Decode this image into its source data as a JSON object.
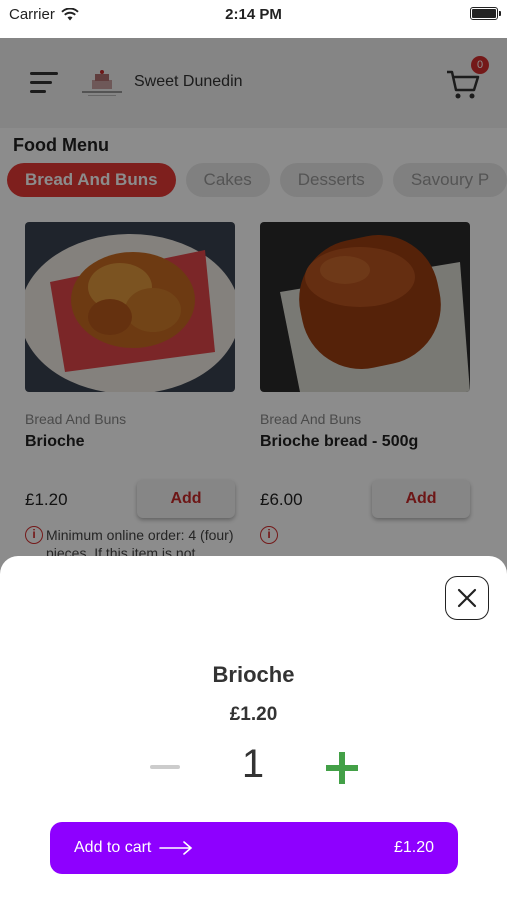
{
  "status_bar": {
    "carrier": "Carrier",
    "time": "2:14 PM"
  },
  "header": {
    "brand": "Sweet Dunedin",
    "cart_count": "0"
  },
  "menu": {
    "title": "Food Menu",
    "categories": [
      "Bread And Buns",
      "Cakes",
      "Desserts",
      "Savoury P"
    ],
    "products": [
      {
        "category": "Bread And Buns",
        "name": "Brioche",
        "price": "£1.20",
        "add_label": "Add",
        "info": "Minimum online order: 4 (four) pieces. If this item is not"
      },
      {
        "category": "Bread And Buns",
        "name": "Brioche bread - 500g",
        "price": "£6.00",
        "add_label": "Add",
        "info": ""
      }
    ]
  },
  "sheet": {
    "name": "Brioche",
    "price": "£1.20",
    "quantity": "1",
    "add_to_cart_label": "Add to cart",
    "total": "£1.20"
  },
  "colors": {
    "accent_red": "#e53935",
    "cart_button": "#8e00ff",
    "plus_green": "#43a047"
  },
  "icons": [
    "wifi-icon",
    "battery-icon",
    "menu-icon",
    "cart-icon",
    "info-icon",
    "close-icon",
    "minus-icon",
    "plus-icon",
    "arrow-right-icon"
  ]
}
